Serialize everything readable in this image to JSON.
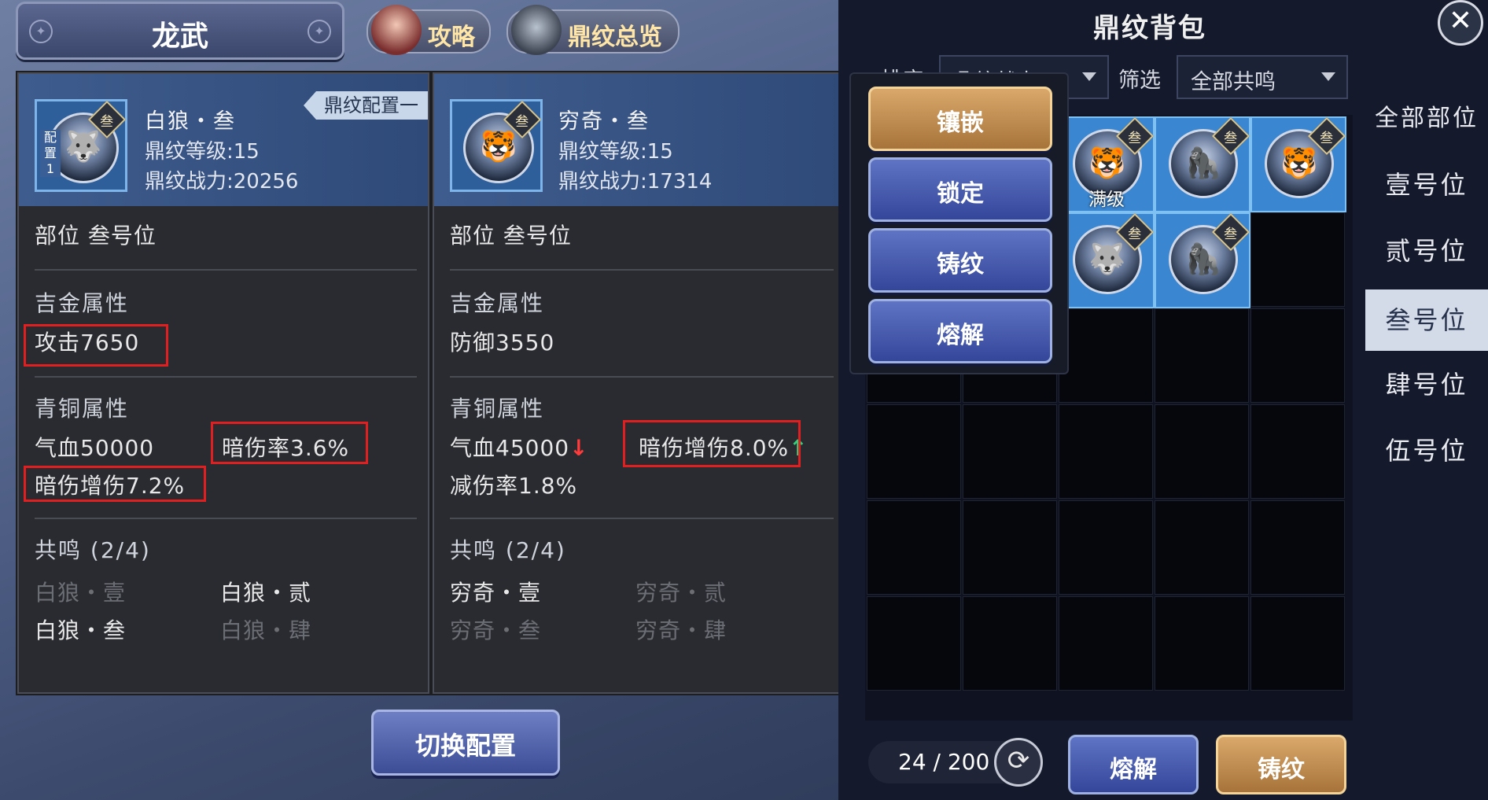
{
  "header": {
    "title": "龙武",
    "guide_label": "攻略",
    "overview_label": "鼎纹总览"
  },
  "left_card": {
    "config_ribbon": "鼎纹配置一",
    "config_tag": "配置1",
    "tier": "叁",
    "name": "白狼・叁",
    "level": "鼎纹等级:15",
    "power": "鼎纹战力:20256",
    "slot": "部位 叁号位",
    "gold_title": "吉金属性",
    "gold_attr": "攻击7650",
    "bronze_title": "青铜属性",
    "bronze_hp": "气血50000",
    "bronze_dark_rate": "暗伤率3.6%",
    "bronze_dark_boost": "暗伤增伤7.2%",
    "resonance_title": "共鸣 (2/4)",
    "resonance": [
      "白狼・壹",
      "白狼・贰",
      "白狼・叁",
      "白狼・肆"
    ]
  },
  "right_card": {
    "tier": "叁",
    "name": "穷奇・叁",
    "level": "鼎纹等级:15",
    "power": "鼎纹战力:17314",
    "slot": "部位 叁号位",
    "gold_title": "吉金属性",
    "gold_attr": "防御3550",
    "bronze_title": "青铜属性",
    "bronze_hp": "气血45000",
    "bronze_dark_boost": "暗伤增伤8.0%",
    "bronze_reduce": "减伤率1.8%",
    "resonance_title": "共鸣 (2/4)",
    "resonance": [
      "穷奇・壹",
      "穷奇・贰",
      "穷奇・叁",
      "穷奇・肆"
    ]
  },
  "switch_label": "切换配置",
  "bag": {
    "title": "鼎纹背包",
    "sort_label": "排序",
    "sort_value": "鼎纹战力",
    "filter_label": "筛选",
    "filter_value": "全部共鸣",
    "count": "24 / 200",
    "max_label": "满级",
    "tier": "叁",
    "melt_label": "熔解",
    "forge_label": "铸纹"
  },
  "context_menu": [
    "镶嵌",
    "锁定",
    "铸纹",
    "熔解"
  ],
  "side_list": [
    "全部部位",
    "壹号位",
    "贰号位",
    "叁号位",
    "肆号位",
    "伍号位"
  ],
  "icons": [
    "close-icon",
    "refresh-icon",
    "wolf-emblem-icon",
    "tiger-emblem-icon",
    "ape-emblem-icon"
  ],
  "colors": {
    "highlight": "#e02020",
    "up": "#33d17a",
    "down": "#ff3b3b",
    "active_tab": "#d3dae8"
  }
}
